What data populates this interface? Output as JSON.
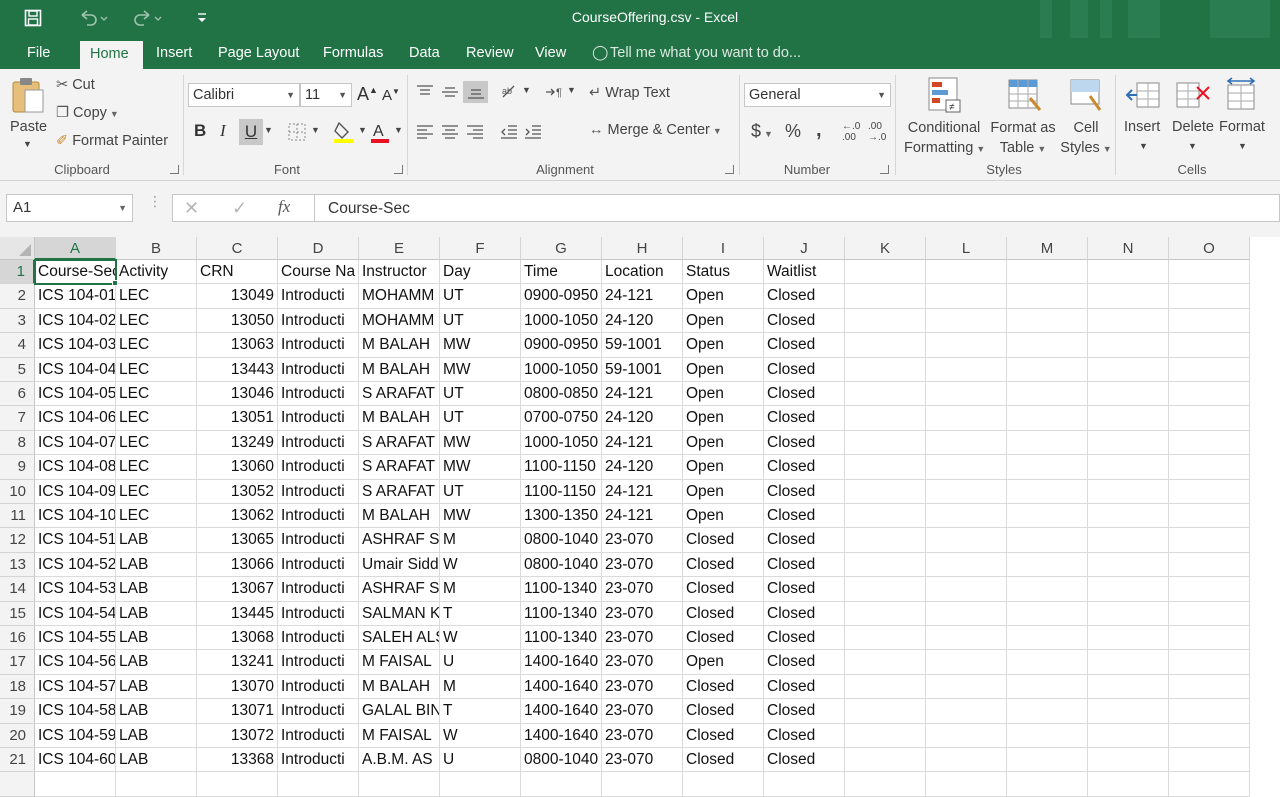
{
  "window": {
    "title": "CourseOffering.csv - Excel"
  },
  "quick_access": {
    "save": "save-icon",
    "undo": "undo-icon",
    "redo": "redo-icon",
    "customize": "customize-icon"
  },
  "tabs": [
    {
      "label": "File"
    },
    {
      "label": "Home"
    },
    {
      "label": "Insert"
    },
    {
      "label": "Page Layout"
    },
    {
      "label": "Formulas"
    },
    {
      "label": "Data"
    },
    {
      "label": "Review"
    },
    {
      "label": "View"
    }
  ],
  "tell_me": "Tell me what you want to do...",
  "ribbon": {
    "clipboard": {
      "paste": "Paste",
      "cut": "Cut",
      "copy": "Copy",
      "format_painter": "Format Painter",
      "label": "Clipboard"
    },
    "font": {
      "name": "Calibri",
      "size": "11",
      "bold": "B",
      "italic": "I",
      "underline": "U",
      "label": "Font"
    },
    "alignment": {
      "wrap_text": "Wrap Text",
      "merge_center": "Merge & Center",
      "label": "Alignment"
    },
    "number": {
      "format": "General",
      "currency": "$",
      "percent": "%",
      "comma": ",",
      "inc_decimal": "←.0 .00",
      "dec_decimal": ".00 →.0",
      "label": "Number"
    },
    "styles": {
      "conditional_1": "Conditional",
      "conditional_2": "Formatting",
      "format_as_1": "Format as",
      "format_as_2": "Table",
      "cell_1": "Cell",
      "cell_2": "Styles",
      "label": "Styles"
    },
    "cells": {
      "insert": "Insert",
      "delete": "Delete",
      "format": "Format",
      "label": "Cells"
    }
  },
  "formula_bar": {
    "name_box": "A1",
    "content": "Course-Sec",
    "fx": "fx"
  },
  "columns": [
    "A",
    "B",
    "C",
    "D",
    "E",
    "F",
    "G",
    "H",
    "I",
    "J",
    "K",
    "L",
    "M",
    "N",
    "O"
  ],
  "rows": [
    [
      "Course-Sec",
      "Activity",
      "CRN",
      "Course Na",
      "Instructor",
      "Day",
      "Time",
      "Location",
      "Status",
      "Waitlist"
    ],
    [
      "ICS 104-01",
      "LEC",
      "13049",
      "Introducti",
      "MOHAMM",
      "UT",
      "0900-0950",
      "24-121",
      "Open",
      "Closed"
    ],
    [
      "ICS 104-02",
      "LEC",
      "13050",
      "Introducti",
      "MOHAMM",
      "UT",
      "1000-1050",
      "24-120",
      "Open",
      "Closed"
    ],
    [
      "ICS 104-03",
      "LEC",
      "13063",
      "Introducti",
      "M BALAH",
      "MW",
      "0900-0950",
      "59-1001",
      "Open",
      "Closed"
    ],
    [
      "ICS 104-04",
      "LEC",
      "13443",
      "Introducti",
      "M BALAH",
      "MW",
      "1000-1050",
      "59-1001",
      "Open",
      "Closed"
    ],
    [
      "ICS 104-05",
      "LEC",
      "13046",
      "Introducti",
      "S ARAFAT",
      "UT",
      "0800-0850",
      "24-121",
      "Open",
      "Closed"
    ],
    [
      "ICS 104-06",
      "LEC",
      "13051",
      "Introducti",
      "M BALAH",
      "UT",
      "0700-0750",
      "24-120",
      "Open",
      "Closed"
    ],
    [
      "ICS 104-07",
      "LEC",
      "13249",
      "Introducti",
      "S ARAFAT",
      "MW",
      "1000-1050",
      "24-121",
      "Open",
      "Closed"
    ],
    [
      "ICS 104-08",
      "LEC",
      "13060",
      "Introducti",
      "S ARAFAT",
      "MW",
      "1100-1150",
      "24-120",
      "Open",
      "Closed"
    ],
    [
      "ICS 104-09",
      "LEC",
      "13052",
      "Introducti",
      "S ARAFAT",
      "UT",
      "1100-1150",
      "24-121",
      "Open",
      "Closed"
    ],
    [
      "ICS 104-10",
      "LEC",
      "13062",
      "Introducti",
      "M BALAH",
      "MW",
      "1300-1350",
      "24-121",
      "Open",
      "Closed"
    ],
    [
      "ICS 104-51",
      "LAB",
      "13065",
      "Introducti",
      "ASHRAF SA",
      "M",
      "0800-1040",
      "23-070",
      "Closed",
      "Closed"
    ],
    [
      "ICS 104-52",
      "LAB",
      "13066",
      "Introducti",
      "Umair Sidd",
      "W",
      "0800-1040",
      "23-070",
      "Closed",
      "Closed"
    ],
    [
      "ICS 104-53",
      "LAB",
      "13067",
      "Introducti",
      "ASHRAF SA",
      "M",
      "1100-1340",
      "23-070",
      "Closed",
      "Closed"
    ],
    [
      "ICS 104-54",
      "LAB",
      "13445",
      "Introducti",
      "SALMAN K",
      "T",
      "1100-1340",
      "23-070",
      "Closed",
      "Closed"
    ],
    [
      "ICS 104-55",
      "LAB",
      "13068",
      "Introducti",
      "SALEH ALS",
      "W",
      "1100-1340",
      "23-070",
      "Closed",
      "Closed"
    ],
    [
      "ICS 104-56",
      "LAB",
      "13241",
      "Introducti",
      "M FAISAL",
      "U",
      "1400-1640",
      "23-070",
      "Open",
      "Closed"
    ],
    [
      "ICS 104-57",
      "LAB",
      "13070",
      "Introducti",
      "M BALAH",
      "M",
      "1400-1640",
      "23-070",
      "Closed",
      "Closed"
    ],
    [
      "ICS 104-58",
      "LAB",
      "13071",
      "Introducti",
      "GALAL BIN",
      "T",
      "1400-1640",
      "23-070",
      "Closed",
      "Closed"
    ],
    [
      "ICS 104-59",
      "LAB",
      "13072",
      "Introducti",
      "M FAISAL",
      "W",
      "1400-1640",
      "23-070",
      "Closed",
      "Closed"
    ],
    [
      "ICS 104-60",
      "LAB",
      "13368",
      "Introducti",
      "A.B.M. AS",
      "U",
      "0800-1040",
      "23-070",
      "Closed",
      "Closed"
    ]
  ],
  "colors": {
    "excel_green": "#217346",
    "ribbon_bg": "#f3f3f3",
    "grid_line": "#dadada"
  }
}
